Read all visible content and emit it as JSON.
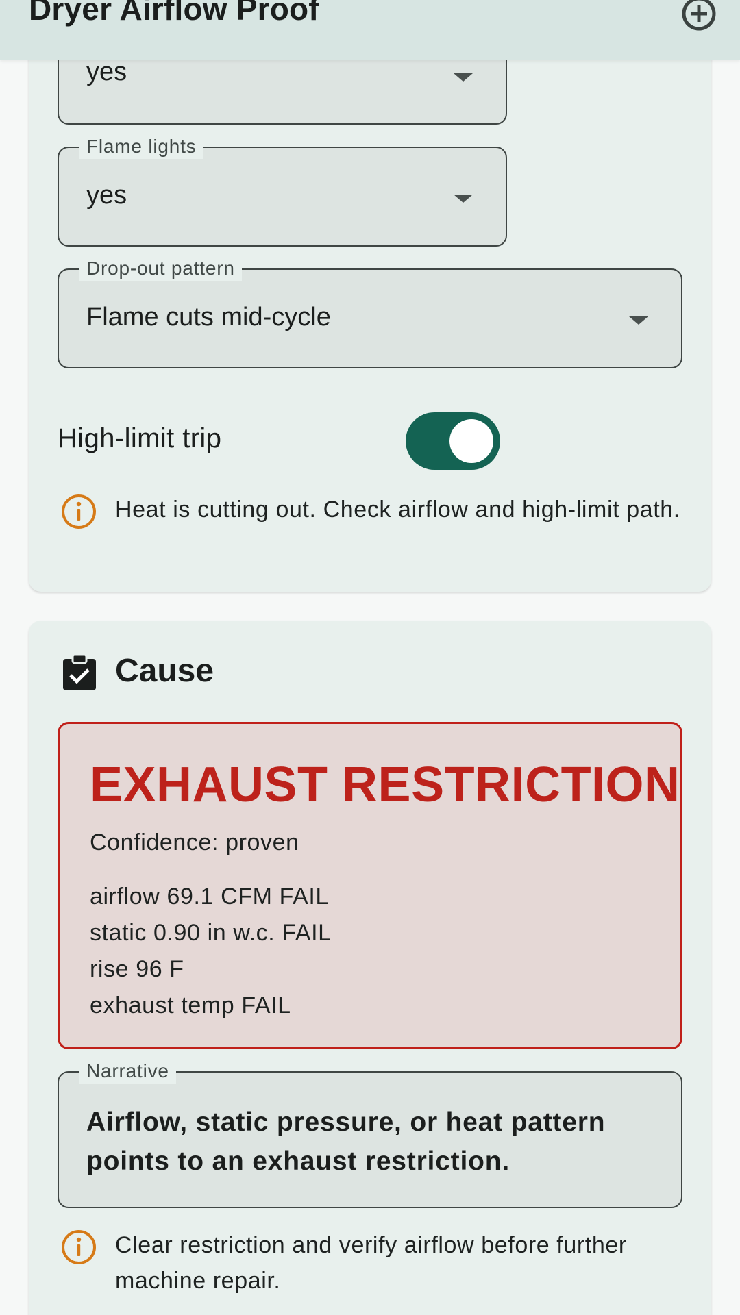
{
  "app_bar": {
    "title": "Dryer Airflow Proof",
    "action_icon": "add-circle-icon"
  },
  "symptoms": {
    "heat_present": {
      "value": "yes"
    },
    "flame_lights": {
      "label": "Flame lights",
      "value": "yes"
    },
    "drop_out_pattern": {
      "label": "Drop-out pattern",
      "value": "Flame cuts mid-cycle"
    },
    "high_limit_trip": {
      "label": "High-limit trip",
      "checked": true
    },
    "info": "Heat is cutting out. Check airflow and high-limit path."
  },
  "cause": {
    "title": "Cause",
    "icon": "clipboard-check-icon",
    "result_title": "EXHAUST RESTRICTION",
    "confidence": "Confidence: proven",
    "lines": [
      "airflow 69.1 CFM FAIL",
      "static 0.90 in w.c. FAIL",
      "rise 96 F",
      "exhaust temp FAIL"
    ],
    "narrative": {
      "label": "Narrative",
      "value": "Airflow, static pressure, or heat pattern points to an exhaust restriction."
    },
    "info": "Clear restriction and verify airflow before further machine repair."
  },
  "colors": {
    "app_bar": "#d7e5e2",
    "card": "#e8f0ed",
    "accent": "#146353",
    "danger": "#bd221b",
    "danger_bg": "#e5d8d6",
    "warning": "#d67a17"
  }
}
